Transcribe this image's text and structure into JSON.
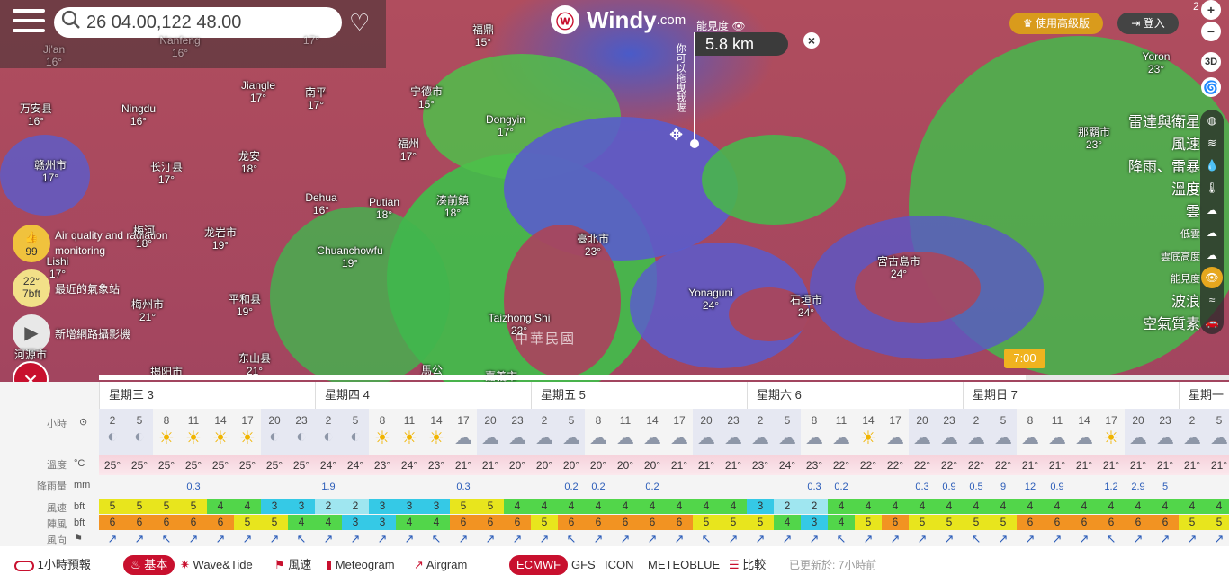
{
  "search": {
    "value": "26 04.00,122 48.00"
  },
  "brand": {
    "name": "Windy",
    "suffix": ".com"
  },
  "visibility": {
    "label": "能見度",
    "value": "5.8 km",
    "hint": "你可以拖曳我喔"
  },
  "header": {
    "premium": "使用高級版",
    "login": "登入",
    "zoom_level": "2"
  },
  "zoom": {
    "plus": "+",
    "minus": "−",
    "mode_3d": "3D"
  },
  "layers": [
    {
      "label": "雷達與衛星",
      "icon": "globe-icon"
    },
    {
      "label": "風速",
      "icon": "wind-icon"
    },
    {
      "label": "降雨、雷暴",
      "icon": "rain-icon"
    },
    {
      "label": "溫度",
      "icon": "thermometer-icon"
    },
    {
      "label": "雲",
      "icon": "cloud-icon"
    },
    {
      "label": "低雲",
      "icon": "low-cloud-icon"
    },
    {
      "label": "雲底高度",
      "icon": "cloud-base-icon"
    },
    {
      "label": "能見度",
      "icon": "eye-icon"
    },
    {
      "label": "波浪",
      "icon": "wave-icon"
    },
    {
      "label": "空氣質素",
      "icon": "car-icon"
    }
  ],
  "left_panel": [
    {
      "badge": "99",
      "label": "Air quality and radiation monitoring"
    },
    {
      "badge": "22°",
      "badge2": "7bft",
      "label": "最近的氣象站"
    },
    {
      "badge": "",
      "label": "新增網路攝影機"
    }
  ],
  "cities": [
    {
      "n": "福鼎",
      "t": "15°"
    },
    {
      "n": "Jiangle",
      "t": "17°"
    },
    {
      "n": "南平",
      "t": "17°"
    },
    {
      "n": "宁德市",
      "t": "15°"
    },
    {
      "n": "Dongyin",
      "t": "17°"
    },
    {
      "n": "万安县",
      "t": "16°"
    },
    {
      "n": "Ningdu",
      "t": "16°"
    },
    {
      "n": "福州",
      "t": "17°"
    },
    {
      "n": "赣州市",
      "t": "17°"
    },
    {
      "n": "长汀县",
      "t": "17°"
    },
    {
      "n": "龙安",
      "t": "18°"
    },
    {
      "n": "Dehua",
      "t": "16°"
    },
    {
      "n": "Putian",
      "t": "18°"
    },
    {
      "n": "湊前鎮",
      "t": "18°"
    },
    {
      "n": "龙岩市",
      "t": "19°"
    },
    {
      "n": "Chuanchowfu",
      "t": "19°"
    },
    {
      "n": "臺北市",
      "t": "23°"
    },
    {
      "n": "宮古島市",
      "t": "24°"
    },
    {
      "n": "梅州市",
      "t": "21°"
    },
    {
      "n": "平和县",
      "t": "19°"
    },
    {
      "n": "Taizhong Shi",
      "t": "22°"
    },
    {
      "n": "Yonaguni",
      "t": "24°"
    },
    {
      "n": "石垣市",
      "t": "24°"
    },
    {
      "n": "东山县",
      "t": "21°"
    },
    {
      "n": "Yoron",
      "t": "23°"
    },
    {
      "n": "那覇市",
      "t": "23°"
    },
    {
      "n": "Lishi",
      "t": "17°"
    },
    {
      "n": "河源市",
      "t": ""
    },
    {
      "n": "Ji'an",
      "t": "16°"
    },
    {
      "n": "Nanfeng",
      "t": "16°"
    },
    {
      "n": "",
      "t": "17°"
    },
    {
      "n": "揭阳市",
      "t": ""
    },
    {
      "n": "馬公",
      "t": ""
    },
    {
      "n": "嘉義市",
      "t": ""
    },
    {
      "n": "梅河",
      "t": "18°"
    }
  ],
  "country_label": "中華民國",
  "timeline": {
    "time": "7:00"
  },
  "forecast": {
    "days": [
      "星期三 3",
      "星期四 4",
      "星期五 5",
      "星期六 6",
      "星期日 7",
      "星期一"
    ],
    "row_labels": {
      "hour": "小時",
      "temp": "溫度",
      "precip": "降雨量",
      "wind": "風速",
      "gust": "陣風",
      "dir": "風向"
    },
    "units": {
      "temp": "°C",
      "precip": "mm",
      "wind": "bft",
      "gust": "bft"
    },
    "hours": [
      "2",
      "5",
      "8",
      "11",
      "14",
      "17",
      "20",
      "23",
      "2",
      "5",
      "8",
      "11",
      "14",
      "17",
      "20",
      "23",
      "2",
      "5",
      "8",
      "11",
      "14",
      "17",
      "20",
      "23",
      "2",
      "5",
      "8",
      "11",
      "14",
      "17",
      "20",
      "23",
      "2",
      "5",
      "8",
      "11",
      "14",
      "17",
      "20",
      "23",
      "2",
      "5"
    ],
    "icons": [
      "◐",
      "◐",
      "☀",
      "☀",
      "☀",
      "☀",
      "◐",
      "◐",
      "◐",
      "◐",
      "☀",
      "☀",
      "☀",
      "☁",
      "☁",
      "☁",
      "☁",
      "☁",
      "☁",
      "☁",
      "☁",
      "☁",
      "☁",
      "☁",
      "☁",
      "☁",
      "☁",
      "☁",
      "☀",
      "☁",
      "☁",
      "☁",
      "☁",
      "☁",
      "☁",
      "☁",
      "☁",
      "☀",
      "☁",
      "☁",
      "☁",
      "☁"
    ],
    "temps": [
      "25°",
      "25°",
      "25°",
      "25°",
      "25°",
      "25°",
      "25°",
      "25°",
      "24°",
      "24°",
      "23°",
      "24°",
      "23°",
      "21°",
      "21°",
      "20°",
      "20°",
      "20°",
      "20°",
      "20°",
      "20°",
      "21°",
      "21°",
      "21°",
      "23°",
      "24°",
      "23°",
      "22°",
      "22°",
      "22°",
      "22°",
      "22°",
      "22°",
      "22°",
      "21°",
      "21°",
      "21°",
      "21°",
      "21°",
      "21°",
      "21°",
      "21°"
    ],
    "precip": [
      "",
      "",
      "",
      "0.3",
      "",
      "",
      "",
      "",
      "1.9",
      "",
      "",
      "",
      "",
      "0.3",
      "",
      "",
      "",
      "0.2",
      "0.2",
      "",
      "0.2",
      "",
      "",
      "",
      "",
      "",
      "0.3",
      "0.2",
      "",
      "",
      "0.3",
      "0.9",
      "0.5",
      "9",
      "12",
      "0.9",
      "",
      "1.2",
      "2.9",
      "5",
      "",
      ""
    ],
    "wind": [
      "5",
      "5",
      "5",
      "5",
      "4",
      "4",
      "3",
      "3",
      "2",
      "2",
      "3",
      "3",
      "3",
      "5",
      "5",
      "4",
      "4",
      "4",
      "4",
      "4",
      "4",
      "4",
      "4",
      "4",
      "3",
      "2",
      "2",
      "4",
      "4",
      "4",
      "4",
      "4",
      "4",
      "4",
      "4",
      "4",
      "4",
      "4",
      "4",
      "4",
      "4",
      "4"
    ],
    "gust": [
      "6",
      "6",
      "6",
      "6",
      "6",
      "5",
      "5",
      "4",
      "4",
      "3",
      "3",
      "4",
      "4",
      "6",
      "6",
      "6",
      "5",
      "6",
      "6",
      "6",
      "6",
      "6",
      "5",
      "5",
      "5",
      "4",
      "3",
      "4",
      "5",
      "6",
      "5",
      "5",
      "5",
      "5",
      "6",
      "6",
      "6",
      "6",
      "6",
      "6",
      "5",
      "5"
    ]
  },
  "bottom": {
    "hourly_toggle": "1小時預報",
    "basic": "基本",
    "wave": "Wave&Tide",
    "wind": "風速",
    "meteogram": "Meteogram",
    "airgram": "Airgram",
    "models": [
      "ECMWF",
      "GFS",
      "ICON",
      "METEOBLUE"
    ],
    "compare": "比較",
    "updated": "已更新於: 7小時前"
  }
}
